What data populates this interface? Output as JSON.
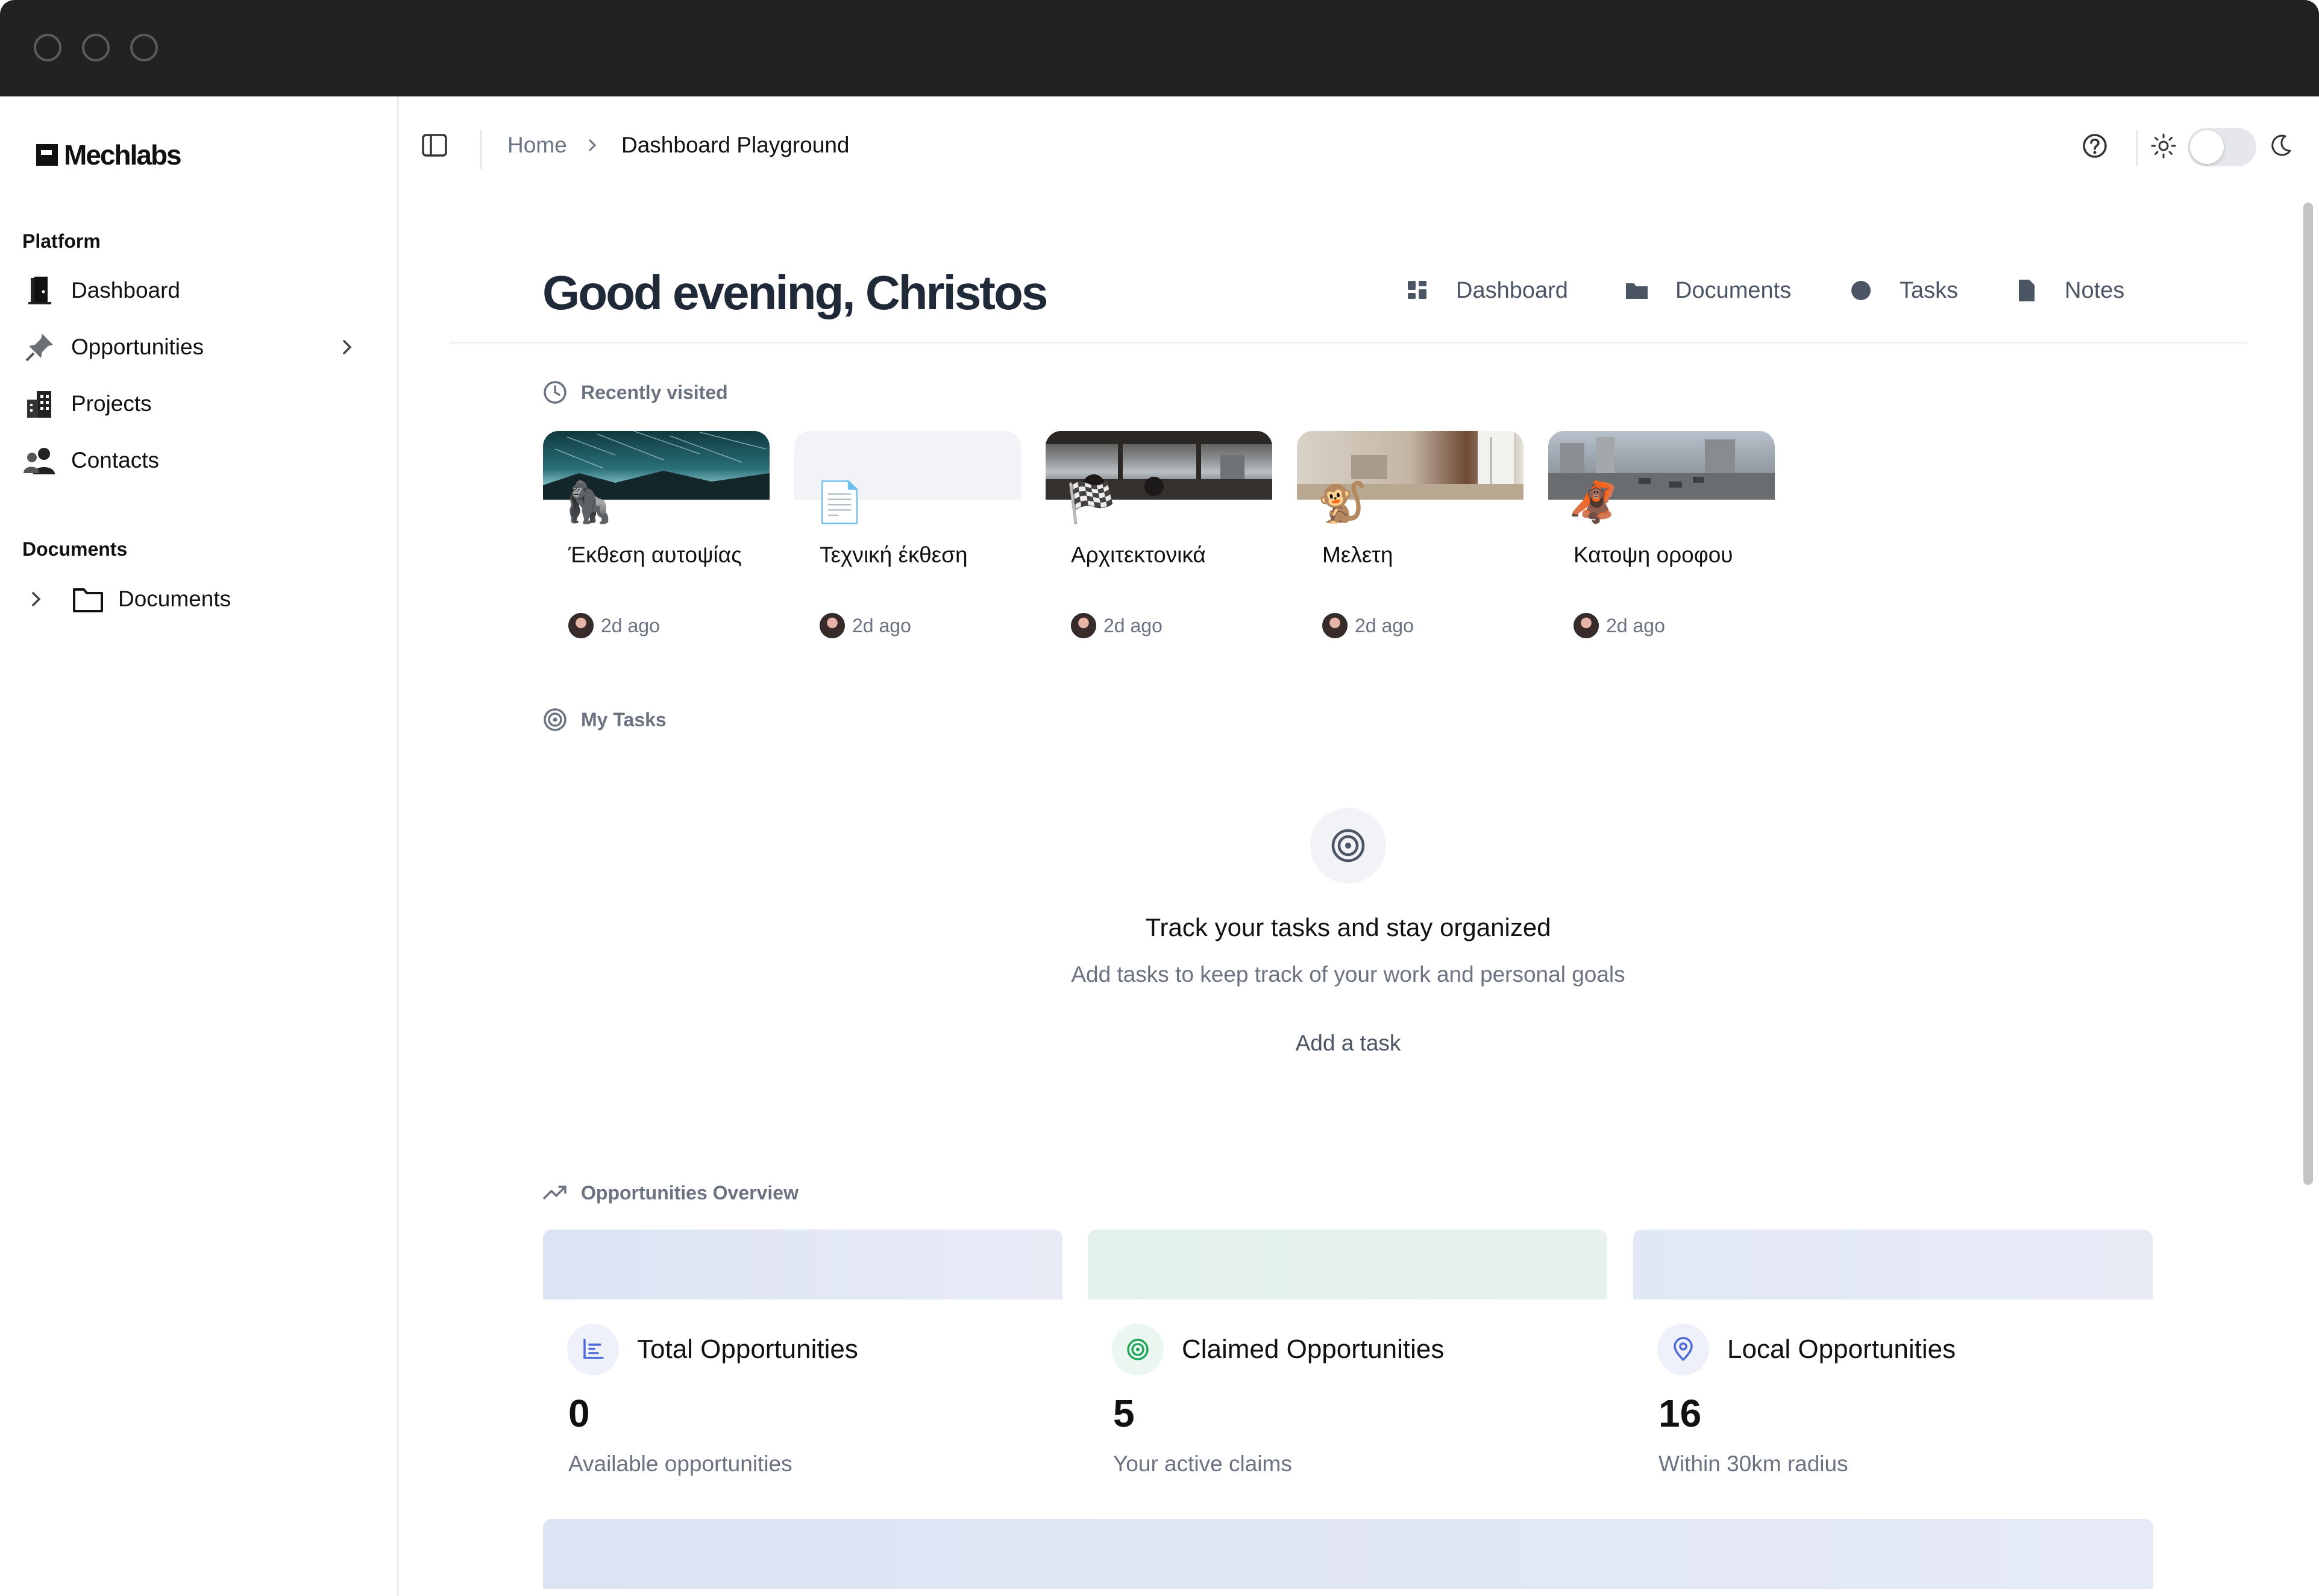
{
  "sidebar": {
    "brand": "Mechlabs",
    "groups": [
      {
        "label": "Platform",
        "items": [
          {
            "label": "Dashboard"
          },
          {
            "label": "Opportunities"
          },
          {
            "label": "Projects"
          },
          {
            "label": "Contacts"
          }
        ]
      },
      {
        "label": "Documents",
        "items": [
          {
            "label": "Documents"
          }
        ]
      }
    ]
  },
  "topbar": {
    "breadcrumb": [
      "Home",
      "Dashboard Playground"
    ],
    "theme_toggle": "off"
  },
  "header": {
    "greeting": "Good evening, Christos",
    "quicknav": [
      {
        "label": "Dashboard",
        "icon": "grid-icon"
      },
      {
        "label": "Documents",
        "icon": "folder-icon"
      },
      {
        "label": "Tasks",
        "icon": "circle-icon"
      },
      {
        "label": "Notes",
        "icon": "file-icon"
      }
    ]
  },
  "recent": {
    "title": "Recently visited",
    "items": [
      {
        "title": "Έκθεση αυτοψίας",
        "time": "2d ago",
        "emoji": "🦍"
      },
      {
        "title": "Τεχνική έκθεση",
        "time": "2d ago",
        "emoji": "📄"
      },
      {
        "title": "Αρχιτεκτονικά",
        "time": "2d ago",
        "emoji": "🏁"
      },
      {
        "title": "Μελετη",
        "time": "2d ago",
        "emoji": "🐒"
      },
      {
        "title": "Κατοψη οροφου",
        "time": "2d ago",
        "emoji": "🦧"
      }
    ]
  },
  "tasks": {
    "title": "My Tasks",
    "empty_title": "Track your tasks and stay organized",
    "empty_subtitle": "Add tasks to keep track of your work and personal goals",
    "add_label": "Add a task"
  },
  "opportunities": {
    "title": "Opportunities Overview",
    "cards": [
      {
        "title": "Total Opportunities",
        "value": "0",
        "subtitle": "Available opportunities",
        "icon": "bar-chart-icon",
        "color": "#4f6bd8"
      },
      {
        "title": "Claimed Opportunities",
        "value": "5",
        "subtitle": "Your active claims",
        "icon": "target-icon",
        "color": "#22a55a"
      },
      {
        "title": "Local Opportunities",
        "value": "16",
        "subtitle": "Within 30km radius",
        "icon": "map-pin-icon",
        "color": "#4f6bd8"
      }
    ]
  }
}
